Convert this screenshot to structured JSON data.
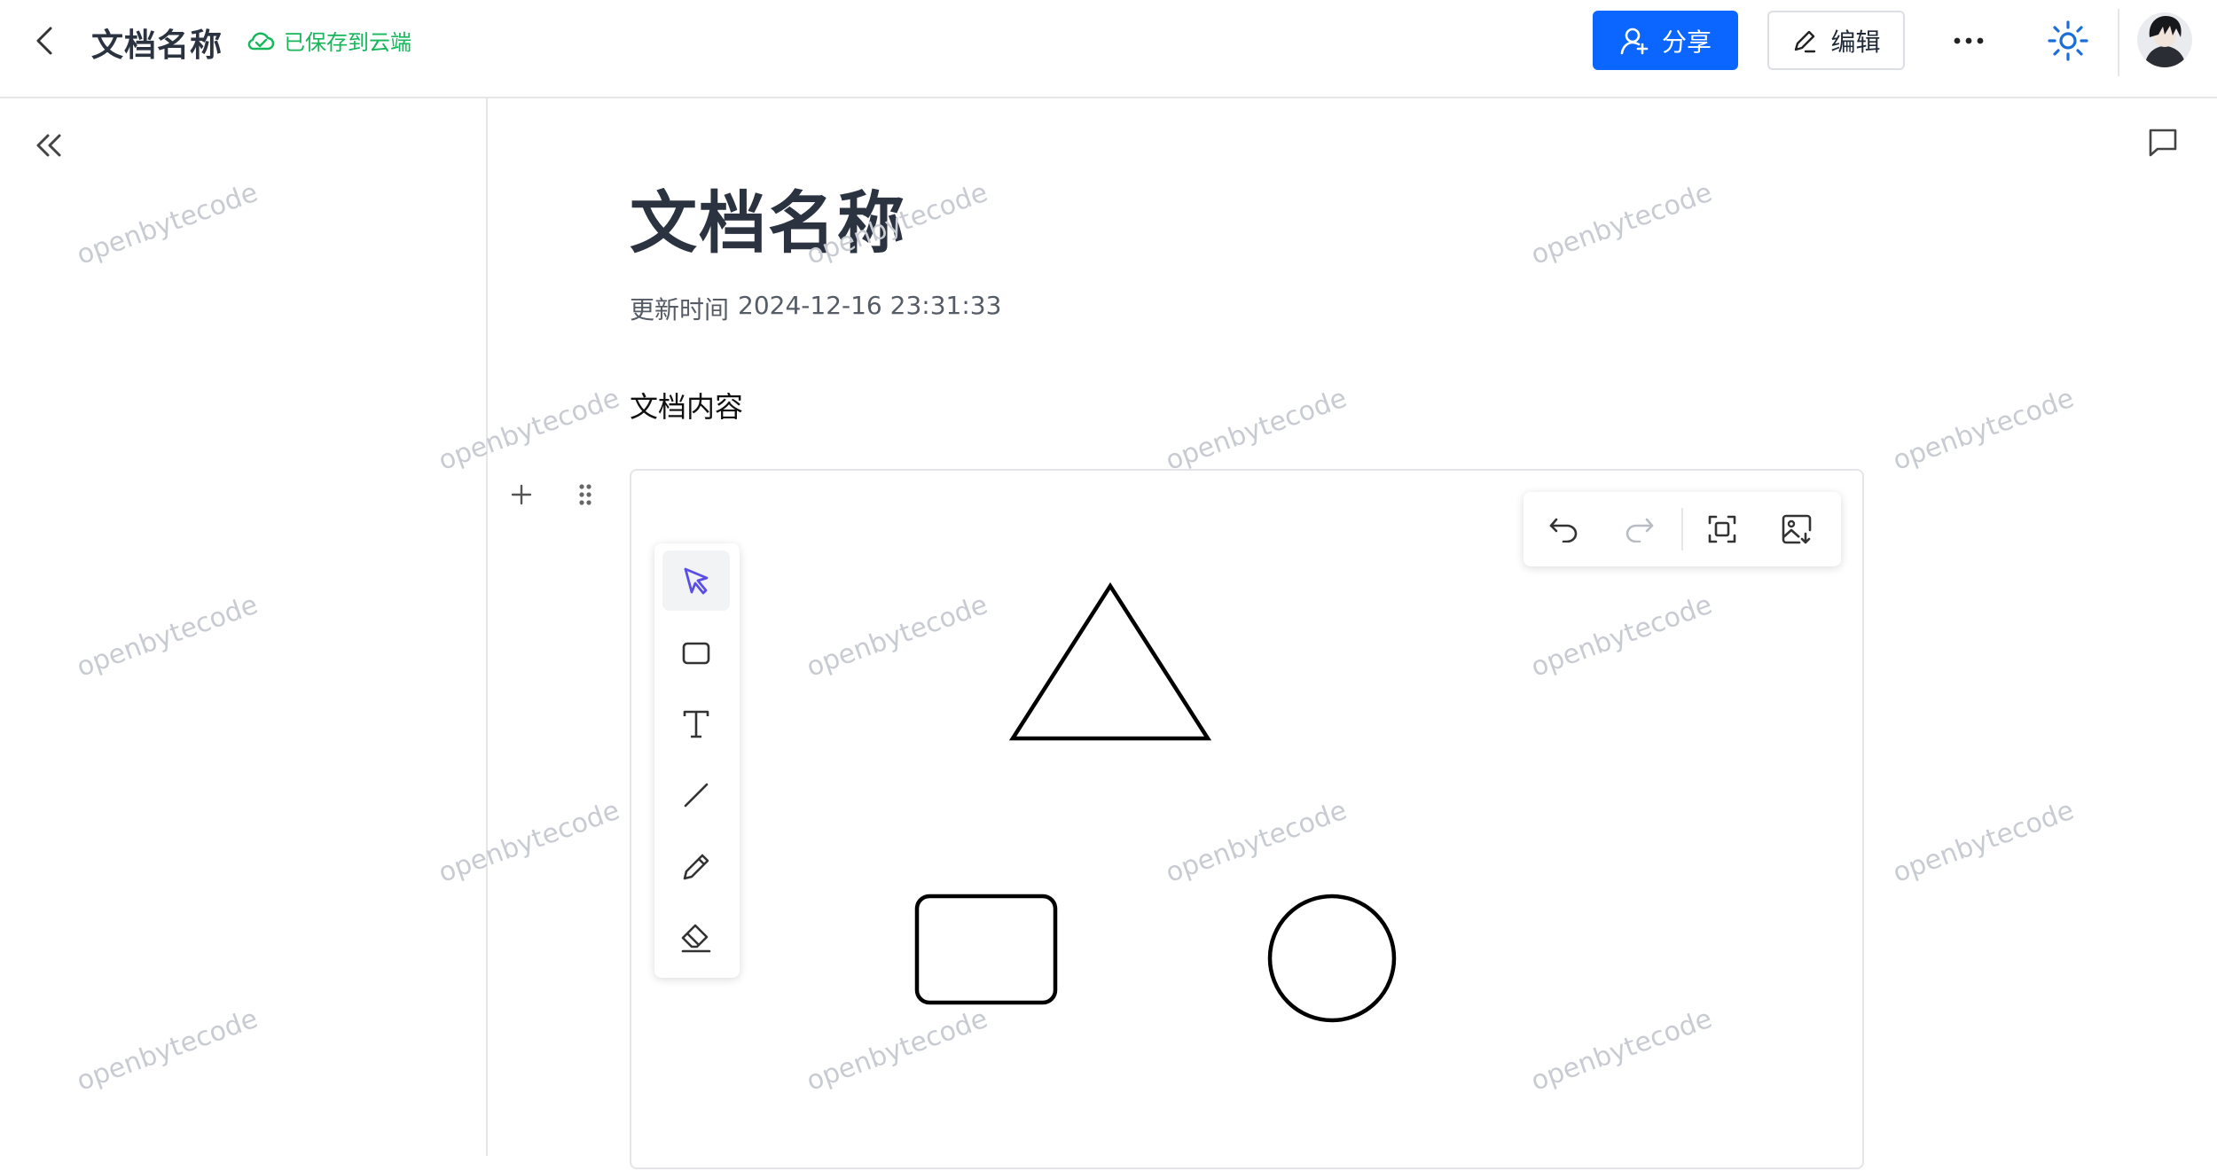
{
  "header": {
    "title": "文档名称",
    "save_status": "已保存到云端",
    "share_label": "分享",
    "edit_label": "编辑"
  },
  "document": {
    "title": "文档名称",
    "updated_label": "更新时间",
    "updated_time": "2024-12-16 23:31:33",
    "content": "文档内容"
  },
  "whiteboard": {
    "tools": [
      "select-icon",
      "rectangle-icon",
      "text-icon",
      "line-icon",
      "pencil-icon",
      "eraser-icon"
    ],
    "active_tool": "select",
    "toolbar": [
      "undo-icon",
      "redo-icon",
      "fit-view-icon",
      "export-image-icon"
    ],
    "shapes": [
      "triangle",
      "rounded-rectangle",
      "circle"
    ]
  },
  "watermark": {
    "text": "openbytecode"
  },
  "colors": {
    "primary": "#0a66ff",
    "saved": "#15b75a",
    "active_tool": "#5b4ee6",
    "theme_icon": "#1a6ed8"
  }
}
